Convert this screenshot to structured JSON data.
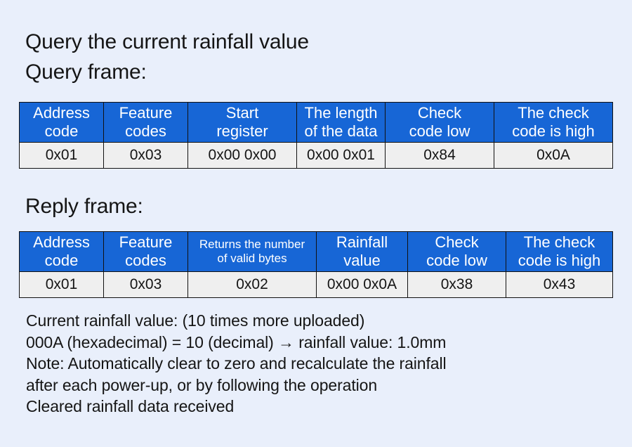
{
  "document": {
    "title": "Query the current rainfall value",
    "query_frame_label": "Query frame:",
    "reply_frame_label": "Reply frame:"
  },
  "colors": {
    "background": "#e9effb",
    "header_blue": "#1766d6",
    "cell_gray": "#efefef",
    "border": "#111111",
    "text": "#151515"
  },
  "query_table": {
    "headers": [
      "Address code",
      "Feature codes",
      "Start register",
      "The length of the data",
      "Check code low",
      "The check code is high"
    ],
    "header_lines": [
      [
        "Address",
        "code"
      ],
      [
        "Feature",
        "codes"
      ],
      [
        "Start",
        "register"
      ],
      [
        "The length",
        "of the data"
      ],
      [
        "Check",
        "code low"
      ],
      [
        "The check",
        "code is high"
      ]
    ],
    "values": [
      "0x01",
      "0x03",
      "0x00  0x00",
      "0x00 0x01",
      "0x84",
      "0x0A"
    ]
  },
  "reply_table": {
    "headers": [
      "Address code",
      "Feature codes",
      "Returns the number of valid bytes",
      "Rainfall value",
      "Check code low",
      "The check code is high"
    ],
    "header_lines": [
      [
        "Address",
        "code"
      ],
      [
        "Feature",
        "codes"
      ],
      [
        "Returns the number",
        "of valid bytes"
      ],
      [
        "Rainfall",
        "value"
      ],
      [
        "Check",
        "code low"
      ],
      [
        "The check",
        "code is high"
      ]
    ],
    "values": [
      "0x01",
      "0x03",
      "0x02",
      "0x00 0x0A",
      "0x38",
      "0x43"
    ]
  },
  "notes": [
    "Current rainfall value: (10 times more uploaded)",
    "000A (hexadecimal) = 10 (decimal) → rainfall value: 1.0mm",
    "Note: Automatically clear to zero and recalculate the rainfall",
    "after each power-up, or by following the operation",
    "Cleared rainfall data received"
  ]
}
